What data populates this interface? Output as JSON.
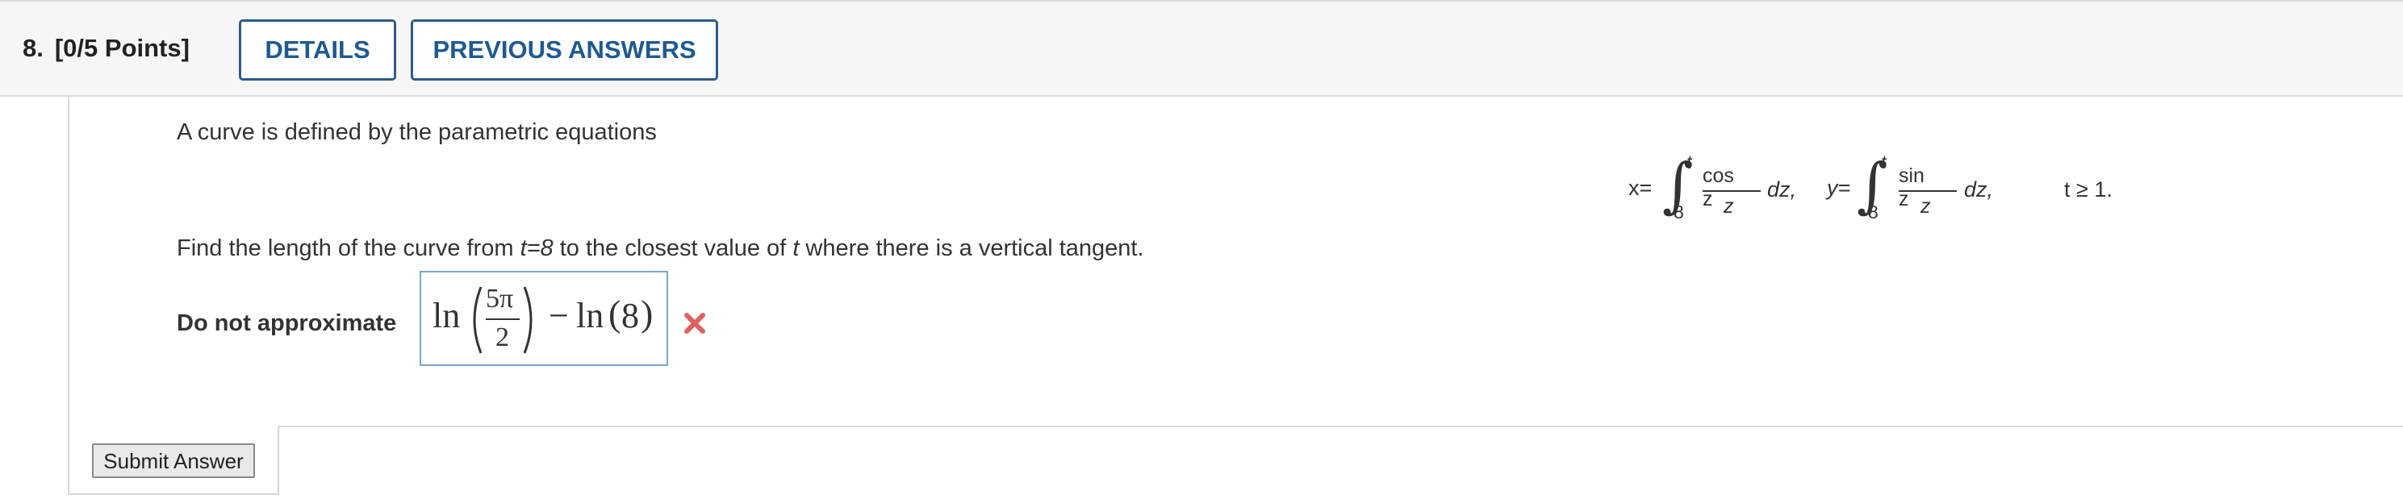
{
  "header": {
    "question_number": "8.",
    "points": "[0/5 Points]",
    "details_label": "DETAILS",
    "previous_answers_label": "PREVIOUS ANSWERS"
  },
  "question": {
    "intro": "A curve is defined by the parametric equations",
    "equation": {
      "x_label": "x=",
      "x_lower": "8",
      "x_upper": "t",
      "x_numerator": "cos z",
      "x_denominator": "z",
      "x_dz": "dz,",
      "y_label": "y=",
      "y_lower": "8",
      "y_upper": "t",
      "y_numerator": "sin z",
      "y_denominator": "z",
      "y_dz": "dz,",
      "condition": "t ≥ 1."
    },
    "prompt_part1": "Find the length of the curve from ",
    "prompt_t_eq": "t=8",
    "prompt_part2": " to the closest value of ",
    "prompt_t": "t",
    "prompt_part3": " where there is a vertical tangent."
  },
  "answer": {
    "label": "Do not approximate",
    "ln1": "ln",
    "frac_num": "5π",
    "frac_den": "2",
    "minus": "−",
    "ln2": "ln",
    "arg2": "8",
    "status": "incorrect",
    "status_color": "#e0605e"
  },
  "footer": {
    "submit_label": "Submit Answer"
  }
}
